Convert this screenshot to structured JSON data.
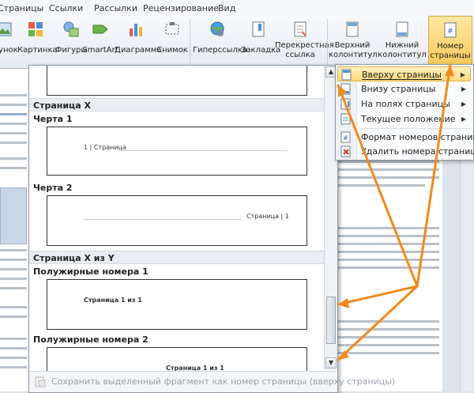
{
  "ribbon": {
    "tabs": [
      "Страницы",
      "Ссылки",
      "Рассылки",
      "Рецензирование",
      "Вид"
    ],
    "buttons": [
      {
        "label": "Рисунок",
        "icon": "picture-icon"
      },
      {
        "label": "Картинка",
        "icon": "clipart-icon"
      },
      {
        "label": "Фигуры",
        "icon": "shapes-icon"
      },
      {
        "label": "SmartArt",
        "icon": "smartart-icon"
      },
      {
        "label": "Диаграмма",
        "icon": "chart-icon"
      },
      {
        "label": "Снимок",
        "icon": "screenshot-icon"
      },
      {
        "label": "Гиперссылка",
        "icon": "hyperlink-icon"
      },
      {
        "label": "Закладка",
        "icon": "bookmark-icon"
      },
      {
        "label": "Перекрестная ссылка",
        "icon": "cross-reference-icon"
      },
      {
        "label": "Верхний колонтитул",
        "icon": "header-icon"
      },
      {
        "label": "Нижний колонтитул",
        "icon": "footer-icon"
      },
      {
        "label": "Номер страницы",
        "icon": "page-number-icon"
      }
    ]
  },
  "gallery": {
    "sections": [
      {
        "title": "Страница X"
      },
      {
        "title": "Страница X из Y"
      }
    ],
    "items": [
      {
        "label": "Черта 1",
        "preview": "1 | Страница"
      },
      {
        "label": "Черта 2",
        "preview": "Страница | 1"
      },
      {
        "label": "Полужирные номера 1",
        "preview": "Страница 1 из 1"
      },
      {
        "label": "Полужирные номера 2",
        "preview": "Страница 1 из 1"
      }
    ],
    "footer": "Сохранить выделенный фрагмент как номер страницы (вверху страницы)"
  },
  "menu": {
    "items": [
      {
        "label": "Вверху страницы",
        "highlighted": true,
        "submenu": true
      },
      {
        "label": "Внизу страницы",
        "submenu": true
      },
      {
        "label": "На полях страницы",
        "submenu": true
      },
      {
        "label": "Текущее положение",
        "submenu": true
      },
      {
        "label": "Формат номеров страниц..."
      },
      {
        "label": "Удалить номера страниц"
      }
    ]
  },
  "colors": {
    "accent_arrow": "#f08a1c",
    "highlight": "#fbd87a"
  }
}
